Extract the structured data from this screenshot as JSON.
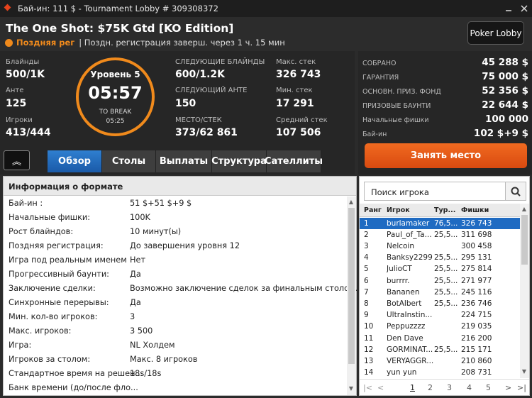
{
  "window": {
    "title": "Бай-ин: 111 $ - Tournament Lobby # 309308372"
  },
  "header": {
    "name": "The One Shot: $75K Gtd [KO Edition]",
    "status": "Поздняя рег",
    "late_info": "| Поздн. регистрация заверш. через 1 ч. 15 мин",
    "lobby_button": "Poker Lobby"
  },
  "stats": {
    "blinds_label": "Блайнды",
    "blinds": "500/1K",
    "ante_label": "Анте",
    "ante": "125",
    "players_label": "Игроки",
    "players": "413/444",
    "next_blinds_label": "СЛЕДУЮЩИЕ БЛАЙНДЫ",
    "next_blinds": "600/1.2K",
    "next_ante_label": "СЛЕДУЮЩИЙ АНТЕ",
    "next_ante": "150",
    "place_label": "МЕСТО/СТЕК",
    "place": "373/62 861",
    "max_stack_label": "Макс. стек",
    "max_stack": "326 743",
    "min_stack_label": "Мин. стек",
    "min_stack": "17 291",
    "avg_stack_label": "Средний стек",
    "avg_stack": "107 506"
  },
  "timer": {
    "level": "Уровень 5",
    "time": "05:57",
    "to_break": "TO BREAK",
    "break_time": "05:25"
  },
  "prize": {
    "rows": [
      {
        "label": "СОБРАНО",
        "value": "45 288 $"
      },
      {
        "label": "ГАРАНТИЯ",
        "value": "75 000 $"
      },
      {
        "label": "ОСНОВН. ПРИЗ. ФОНД",
        "value": "52 356 $"
      },
      {
        "label": "ПРИЗОВЫЕ БАУНТИ",
        "value": "22 644 $"
      },
      {
        "label": "Начальные фишки",
        "value": "100 000"
      },
      {
        "label": "Бай-ин",
        "value": "102 $+9 $"
      }
    ],
    "take_seat": "Занять место"
  },
  "collapse_glyph": "︽",
  "tabs": [
    "Обзор",
    "Столы",
    "Выплаты",
    "Структура",
    "Сателлиты"
  ],
  "info": {
    "title": "Информация о формате",
    "rows": [
      {
        "k": "Бай-ин :",
        "v": "51 $+51 $+9 $"
      },
      {
        "k": "Начальные фишки:",
        "v": "100K"
      },
      {
        "k": "Рост блайндов:",
        "v": "10 минут(ы)"
      },
      {
        "k": "Поздняя регистрация:",
        "v": "До завершения уровня 12"
      },
      {
        "k": "Игра под реальным именем",
        "v": "Нет"
      },
      {
        "k": "Прогрессивный баунти:",
        "v": "Да"
      },
      {
        "k": "Заключение сделки:",
        "v": "Возможно заключение сделок за финальным столом."
      },
      {
        "k": "Синхронные перерывы:",
        "v": "Да"
      },
      {
        "k": "Мин. кол-во игроков:",
        "v": "3"
      },
      {
        "k": "Макс. игроков:",
        "v": "3 500"
      },
      {
        "k": "Игра:",
        "v": "NL Холдем"
      },
      {
        "k": "Игроков за столом:",
        "v": "Макс. 8 игроков"
      },
      {
        "k": "Стандартное время на решен...",
        "v": "18s/18s"
      },
      {
        "k": "Банк времени (до/после фло...",
        "v": ""
      }
    ]
  },
  "players": {
    "search_placeholder": "Поиск игрока",
    "headers": [
      "Ранг",
      "Игрок",
      "Тур...",
      "Фишки"
    ],
    "rows": [
      {
        "rank": "1",
        "name": "burlamaker",
        "tour": "76,5...",
        "chips": "326 743"
      },
      {
        "rank": "2",
        "name": "Paul_of_Ta...",
        "tour": "25,5...",
        "chips": "311 698"
      },
      {
        "rank": "3",
        "name": "Nelcoin",
        "tour": "",
        "chips": "300 458"
      },
      {
        "rank": "4",
        "name": "Banksy2299",
        "tour": "25,5...",
        "chips": "295 131"
      },
      {
        "rank": "5",
        "name": "JulioCT",
        "tour": "25,5...",
        "chips": "275 814"
      },
      {
        "rank": "6",
        "name": "burrrr.",
        "tour": "25,5...",
        "chips": "271 977"
      },
      {
        "rank": "7",
        "name": "Bananen",
        "tour": "25,5...",
        "chips": "245 116"
      },
      {
        "rank": "8",
        "name": "BotAlbert",
        "tour": "25,5...",
        "chips": "236 746"
      },
      {
        "rank": "9",
        "name": "UltraInstin...",
        "tour": "",
        "chips": "224 715"
      },
      {
        "rank": "10",
        "name": "Peppuzzzz",
        "tour": "",
        "chips": "219 035"
      },
      {
        "rank": "11",
        "name": "Den Dave",
        "tour": "",
        "chips": "216 200"
      },
      {
        "rank": "12",
        "name": "GORMINAT...",
        "tour": "25,5...",
        "chips": "215 171"
      },
      {
        "rank": "13",
        "name": "VERYAGGR...",
        "tour": "",
        "chips": "210 860"
      },
      {
        "rank": "14",
        "name": "yun yun",
        "tour": "",
        "chips": "208 731"
      }
    ],
    "pages": [
      "1",
      "2",
      "3",
      "4",
      "5"
    ]
  }
}
